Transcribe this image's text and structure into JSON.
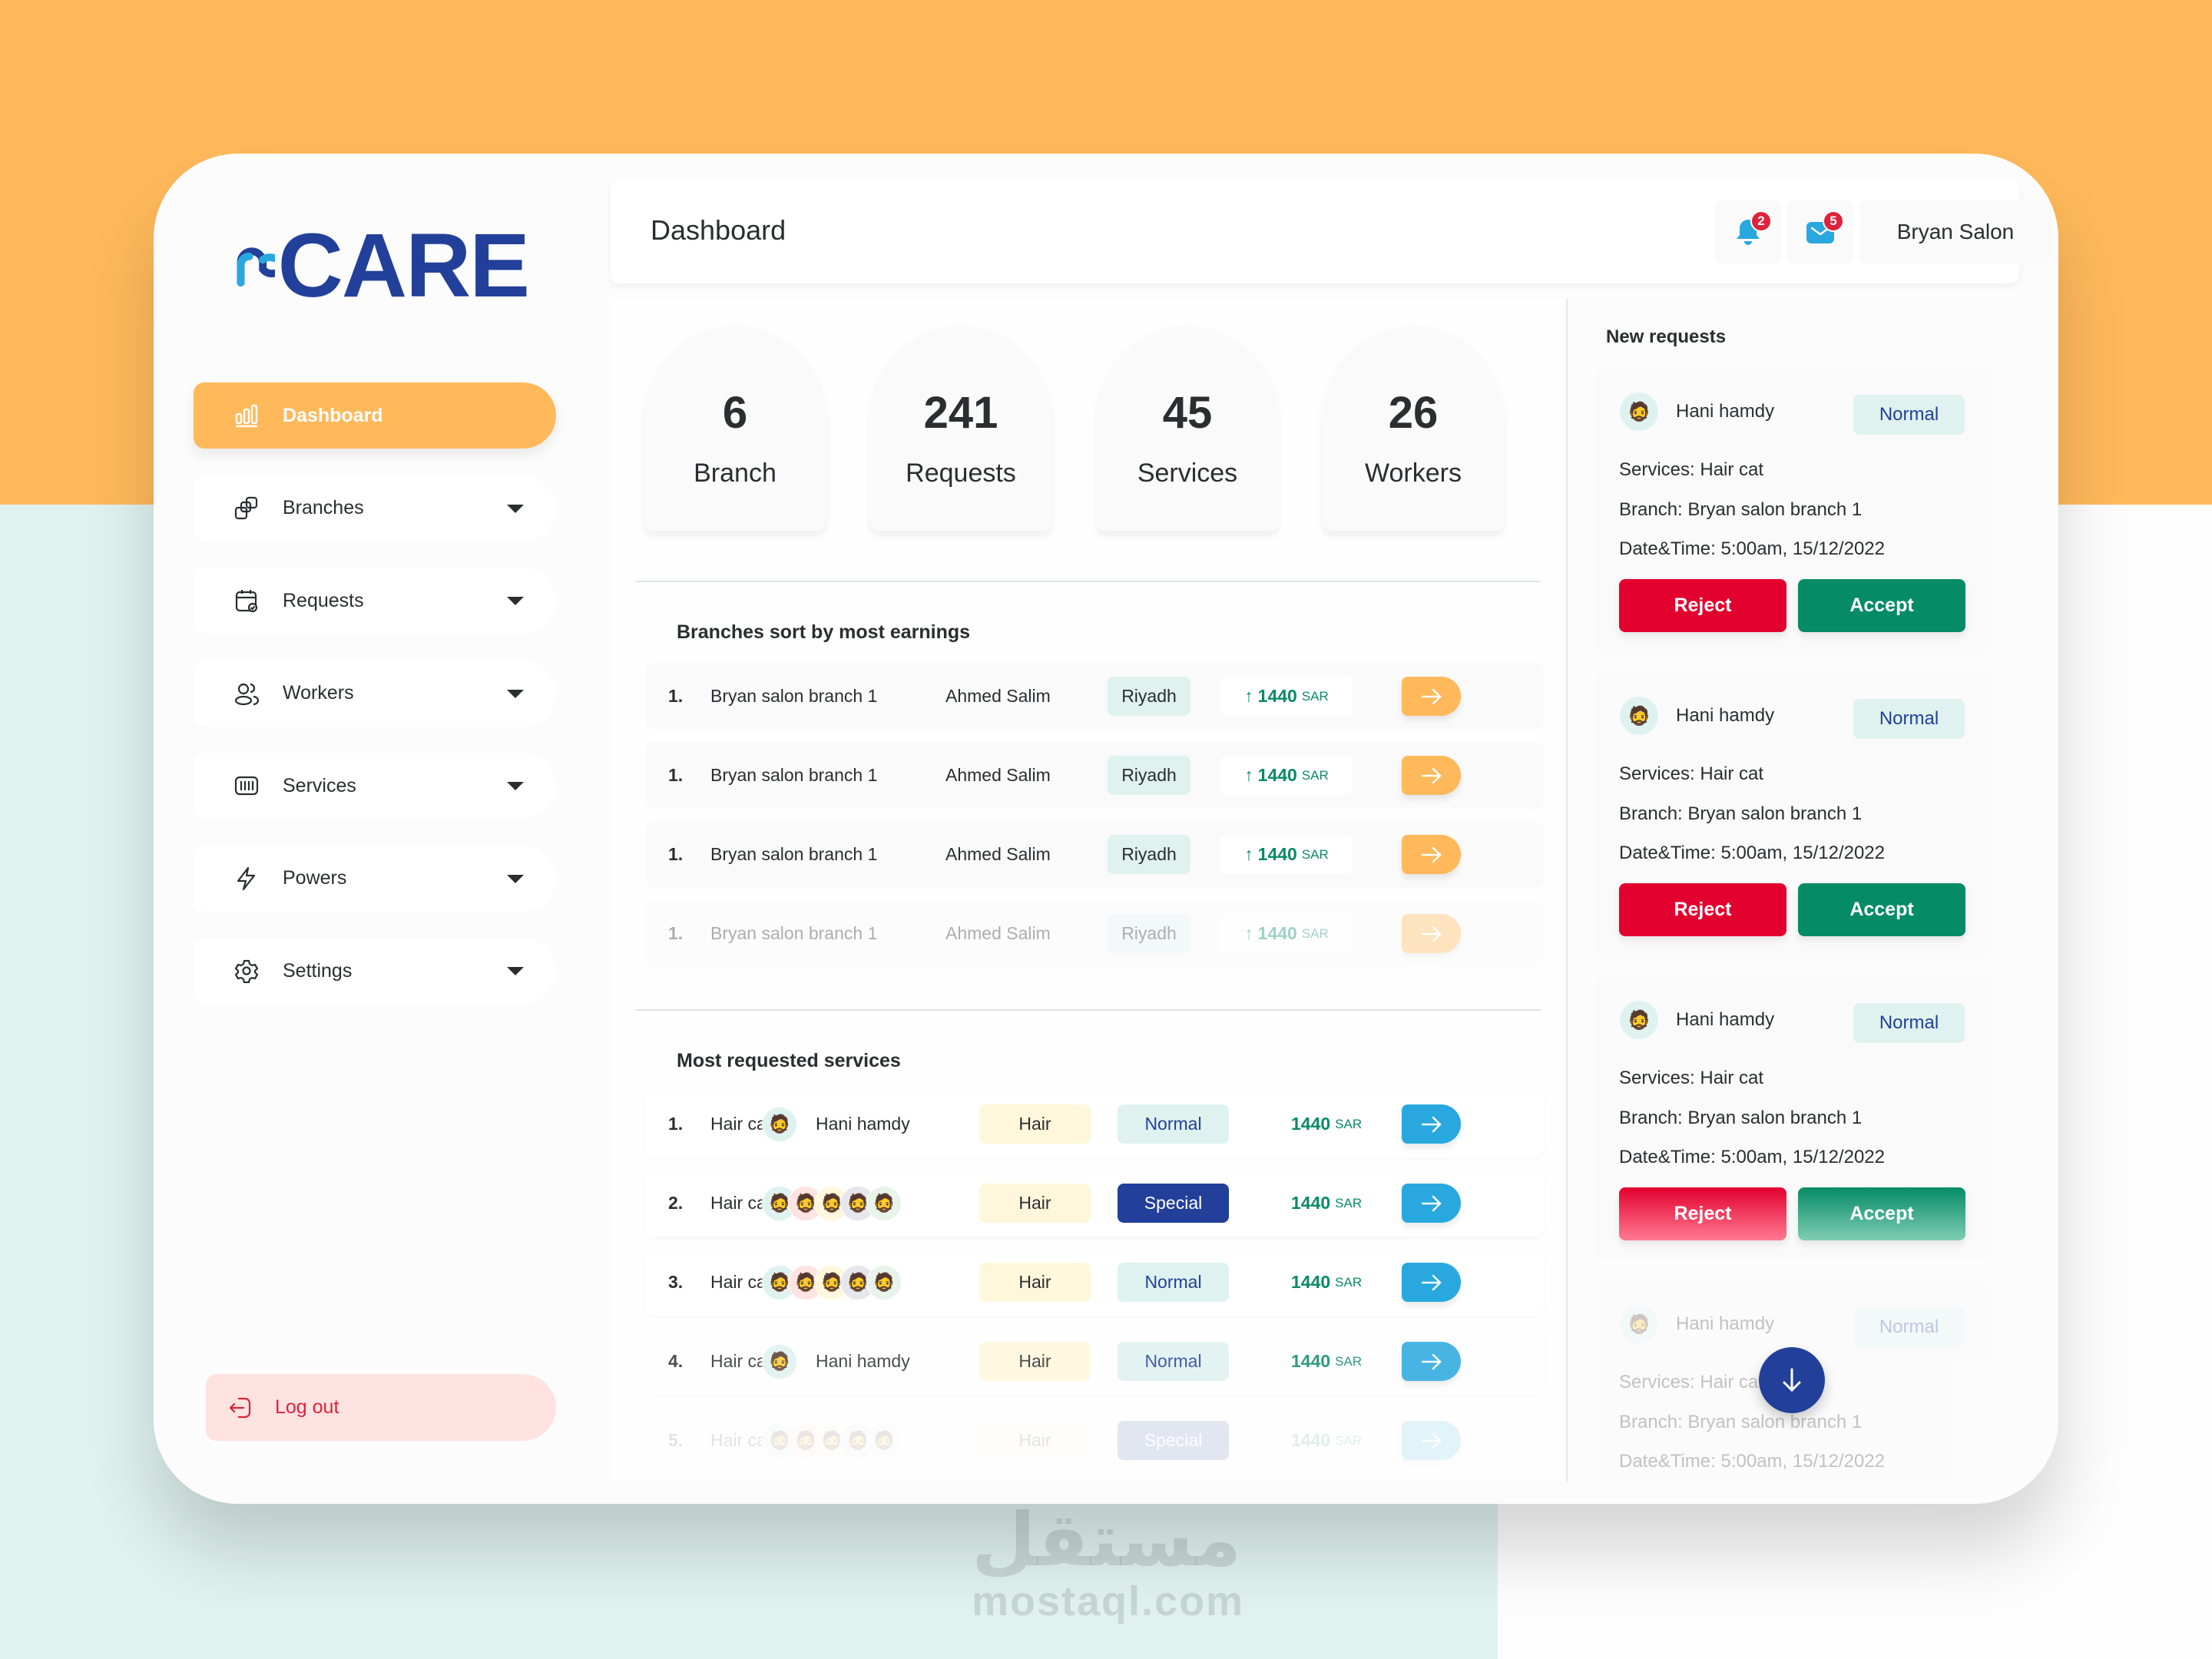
{
  "brand": {
    "logo_text": "CARE",
    "colors": {
      "primary": "#22409a",
      "accent": "#29a8e0",
      "orange": "#ffb95b",
      "danger": "#e2002f",
      "success": "#058b66"
    }
  },
  "sidebar": {
    "items": [
      {
        "label": "Dashboard",
        "icon": "bar-chart-icon",
        "active": true
      },
      {
        "label": "Branches",
        "icon": "branches-icon"
      },
      {
        "label": "Requests",
        "icon": "calendar-check-icon"
      },
      {
        "label": "Workers",
        "icon": "users-icon"
      },
      {
        "label": "Services",
        "icon": "services-icon"
      },
      {
        "label": "Powers",
        "icon": "lightning-icon"
      },
      {
        "label": "Settings",
        "icon": "gear-icon"
      }
    ],
    "logout_label": "Log out"
  },
  "header": {
    "title": "Dashboard",
    "notifications_count": "2",
    "messages_count": "5",
    "user_name": "Bryan Salon"
  },
  "stats": [
    {
      "value": "6",
      "label": "Branch"
    },
    {
      "value": "241",
      "label": "Requests"
    },
    {
      "value": "45",
      "label": "Services"
    },
    {
      "value": "26",
      "label": "Workers"
    }
  ],
  "branches": {
    "title": "Branches sort by most earnings",
    "rows": [
      {
        "num": "1.",
        "name": "Bryan salon branch 1",
        "manager": "Ahmed Salim",
        "city": "Riyadh",
        "earnings": "1440",
        "currency": "SAR"
      },
      {
        "num": "1.",
        "name": "Bryan salon branch 1",
        "manager": "Ahmed Salim",
        "city": "Riyadh",
        "earnings": "1440",
        "currency": "SAR"
      },
      {
        "num": "1.",
        "name": "Bryan salon branch 1",
        "manager": "Ahmed Salim",
        "city": "Riyadh",
        "earnings": "1440",
        "currency": "SAR"
      },
      {
        "num": "1.",
        "name": "Bryan salon branch 1",
        "manager": "Ahmed Salim",
        "city": "Riyadh",
        "earnings": "1440",
        "currency": "SAR"
      }
    ]
  },
  "services": {
    "title": "Most requested services",
    "rows": [
      {
        "num": "1.",
        "name": "Hair cat",
        "worker": "Hani hamdy",
        "category": "Hair",
        "type": "Normal",
        "price": "1440",
        "currency": "SAR"
      },
      {
        "num": "2.",
        "name": "Hair cat",
        "worker": "",
        "category": "Hair",
        "type": "Special",
        "price": "1440",
        "currency": "SAR"
      },
      {
        "num": "3.",
        "name": "Hair cat",
        "worker": "",
        "category": "Hair",
        "type": "Normal",
        "price": "1440",
        "currency": "SAR"
      },
      {
        "num": "4.",
        "name": "Hair cat",
        "worker": "Hani hamdy",
        "category": "Hair",
        "type": "Normal",
        "price": "1440",
        "currency": "SAR"
      },
      {
        "num": "5.",
        "name": "Hair cat",
        "worker": "",
        "category": "Hair",
        "type": "Special",
        "price": "1440",
        "currency": "SAR"
      }
    ]
  },
  "new_requests": {
    "title": "New requests",
    "items": [
      {
        "name": "Hani hamdy",
        "type": "Normal",
        "service": "Services: Hair cat",
        "branch": "Branch: Bryan salon branch 1",
        "datetime": "Date&Time: 5:00am, 15/12/2022",
        "reject": "Reject",
        "accept": "Accept"
      },
      {
        "name": "Hani hamdy",
        "type": "Normal",
        "service": "Services: Hair cat",
        "branch": "Branch: Bryan salon branch 1",
        "datetime": "Date&Time: 5:00am, 15/12/2022",
        "reject": "Reject",
        "accept": "Accept"
      },
      {
        "name": "Hani hamdy",
        "type": "Normal",
        "service": "Services: Hair cat",
        "branch": "Branch: Bryan salon branch 1",
        "datetime": "Date&Time: 5:00am, 15/12/2022",
        "reject": "Reject",
        "accept": "Accept"
      },
      {
        "name": "Hani hamdy",
        "type": "Normal",
        "service": "Services: Hair cat",
        "branch": "Branch: Bryan salon branch 1",
        "datetime": "Date&Time: 5:00am, 15/12/2022"
      }
    ]
  },
  "watermark": {
    "arabic": "مستقل",
    "latin": "mostaql.com"
  }
}
